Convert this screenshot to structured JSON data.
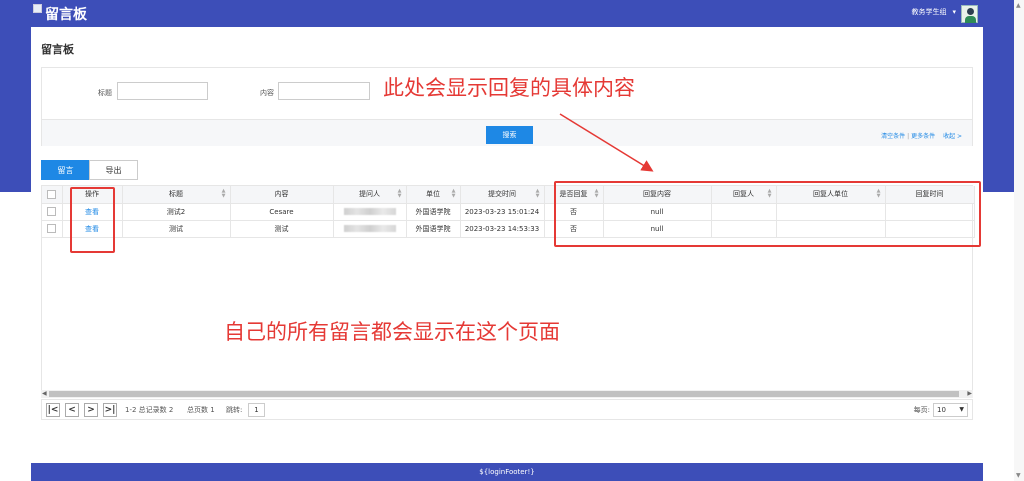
{
  "app": {
    "title": "留言板",
    "user_name": "教务学生组",
    "user_caret": "▾"
  },
  "page": {
    "title": "留言板"
  },
  "filter": {
    "title_label": "标题",
    "title_value": "",
    "content_label": "内容",
    "content_value": "",
    "search_label": "搜索",
    "clear_link": "清空条件",
    "sep": "|",
    "more_link": "更多条件",
    "collapse_link": "收起 >"
  },
  "tabs": [
    {
      "label": "留言",
      "active": true
    },
    {
      "label": "导出",
      "active": false
    }
  ],
  "table": {
    "columns": [
      "操作",
      "标题",
      "内容",
      "提问人",
      "单位",
      "提交时间",
      "是否回复",
      "回复内容",
      "回复人",
      "回复人单位",
      "回复时间"
    ],
    "rows": [
      {
        "action": "查看",
        "title": "测试2",
        "content": "Cesare",
        "asker": "",
        "unit": "外国语学院",
        "time": "2023-03-23 15:01:24",
        "replied": "否",
        "reply_content": "null",
        "replier": "",
        "replier_unit": "",
        "reply_time": ""
      },
      {
        "action": "查看",
        "title": "测试",
        "content": "测试",
        "asker": "",
        "unit": "外国语学院",
        "time": "2023-03-23 14:53:33",
        "replied": "否",
        "reply_content": "null",
        "replier": "",
        "replier_unit": "",
        "reply_time": ""
      }
    ]
  },
  "pager": {
    "first": "|<",
    "prev": "<",
    "next": ">",
    "last": ">|",
    "range_text": "1-2 总记录数 2",
    "pages_text": "总页数 1",
    "jump_label": "跳转:",
    "jump_value": "1",
    "per_page_label": "每页:",
    "per_page_value": "10"
  },
  "footer": {
    "text": "${loginFooter!}"
  },
  "annotations": {
    "reply_note": "此处会显示回复的具体内容",
    "all_messages_note": "自己的所有留言都会显示在这个页面",
    "color": "#e53935"
  },
  "colors": {
    "brand": "#3d4eb8",
    "accent": "#1e88e5"
  }
}
